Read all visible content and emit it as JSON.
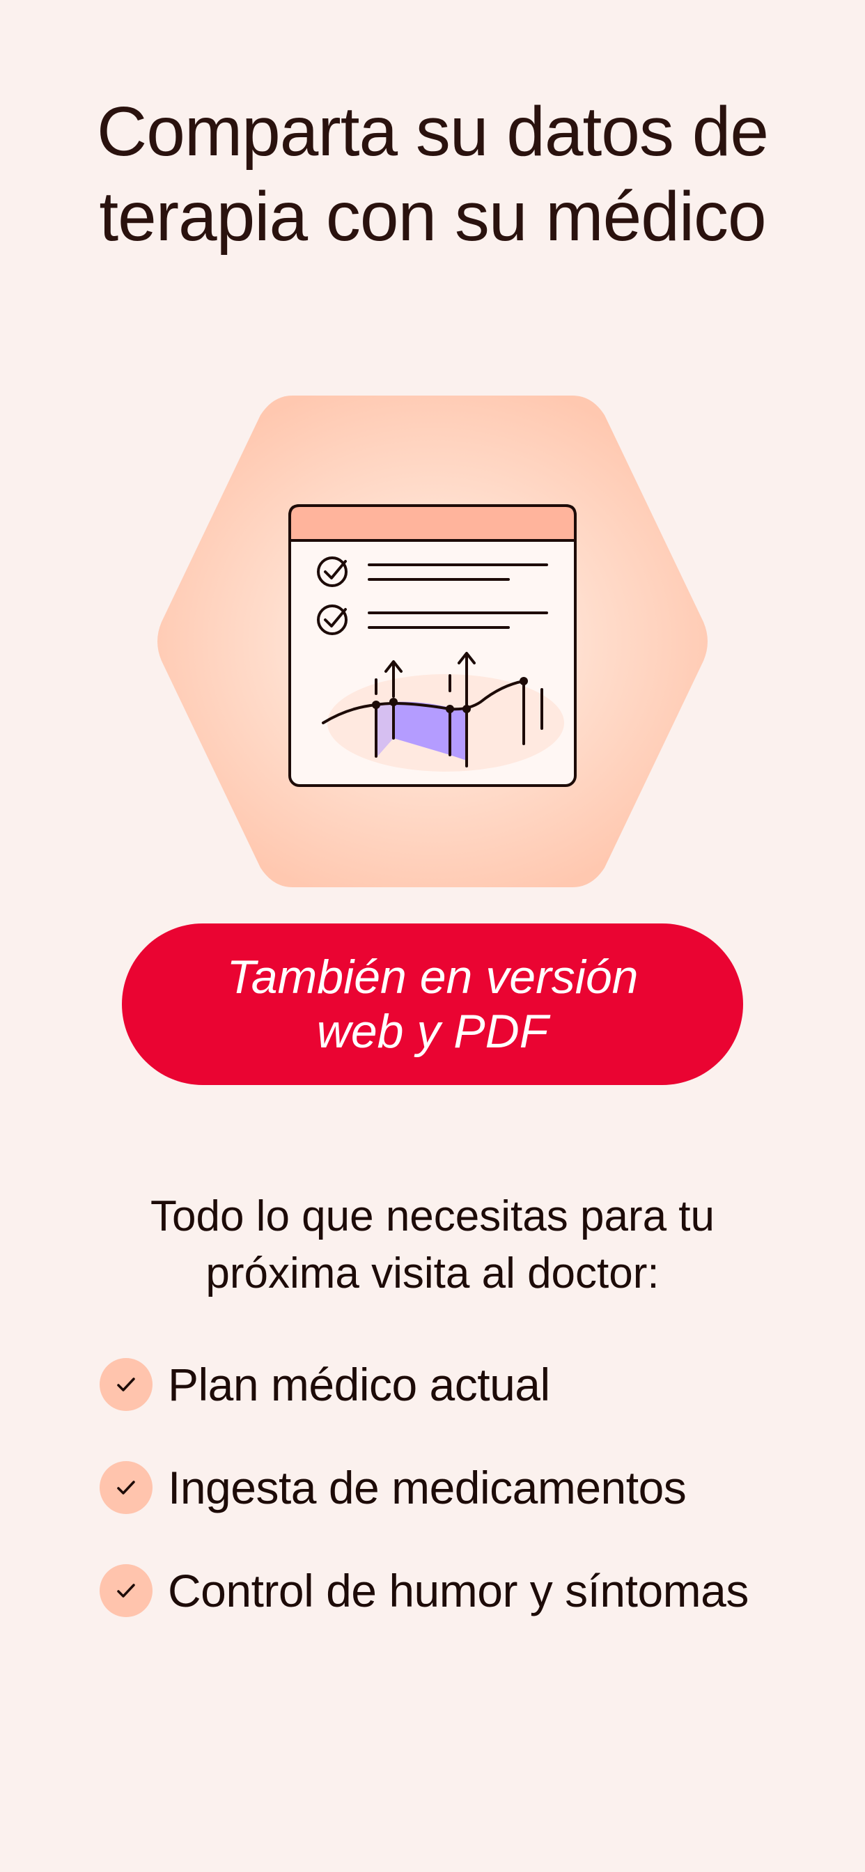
{
  "headline": {
    "line1": "Comparta su datos de",
    "line2": "terapia con su médico"
  },
  "badge": {
    "line1": "También en versión",
    "line2": "web y  PDF"
  },
  "subtitle": {
    "line1": "Todo lo que necesitas para tu",
    "line2": "próxima visita al doctor:"
  },
  "features": [
    {
      "label": "Plan médico actual",
      "icon": "check-icon"
    },
    {
      "label": "Ingesta de medicamentos",
      "icon": "check-icon"
    },
    {
      "label": "Control de humor y síntomas",
      "icon": "check-icon"
    }
  ],
  "hero": {
    "icon": "report-chart-illustration"
  },
  "colors": {
    "background": "#fbf1ee",
    "text": "#2a120e",
    "accent": "#ea0432",
    "check_circle": "#ffc4ad",
    "hexagon": "#ffccb6",
    "window_header": "#ffb49c",
    "chart_fill": "#b49cff"
  }
}
